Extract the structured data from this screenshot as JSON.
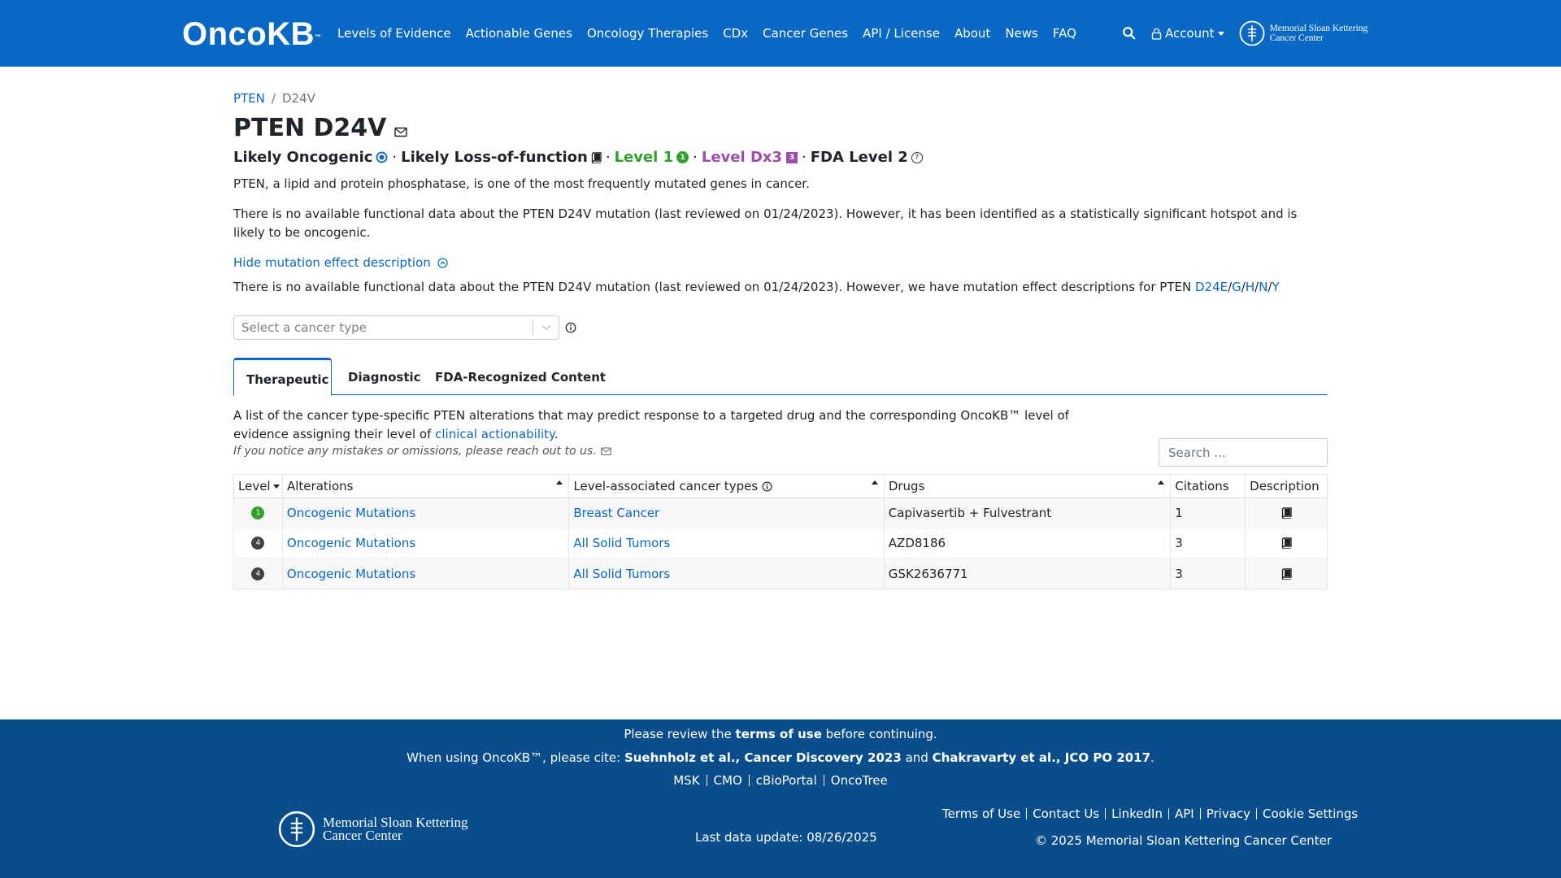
{
  "nav": {
    "logo_text": "OncoKB",
    "logo_tm": "™",
    "items": [
      "Levels of Evidence",
      "Actionable Genes",
      "Oncology Therapies",
      "CDx",
      "Cancer Genes",
      "API / License",
      "About",
      "News",
      "FAQ"
    ],
    "account_label": "Account",
    "msk_line1": "Memorial Sloan Kettering",
    "msk_line2": "Cancer Center"
  },
  "breadcrumb": {
    "gene": "PTEN",
    "sep": "/",
    "alteration": "D24V"
  },
  "title": "PTEN D24V",
  "summary": {
    "oncogenicity": "Likely Oncogenic",
    "mutation_effect": "Likely Loss-of-function",
    "level1": "Level 1",
    "level1_badge": "1",
    "level_dx": "Level Dx3",
    "level_dx_badge": "3",
    "fda_level": "FDA Level 2",
    "dot": "·",
    "help": "?"
  },
  "gene_summary": "PTEN, a lipid and protein phosphatase, is one of the most frequently mutated genes in cancer.",
  "variant_summary": "There is no available functional data about the PTEN D24V mutation (last reviewed on 01/24/2023). However, it has been identified as a statistically significant hotspot and is likely to be oncogenic.",
  "toggle_label": "Hide mutation effect description",
  "mutation_effect_text": "There is no available functional data about the PTEN D24V mutation (last reviewed on 01/24/2023). However, we have mutation effect descriptions for PTEN ",
  "mutation_links": [
    "D24E",
    "G",
    "H",
    "N",
    "Y"
  ],
  "link_sep": "/",
  "cancer_type_select": {
    "placeholder": "Select a cancer type"
  },
  "tabs": [
    "Therapeutic",
    "Diagnostic",
    "FDA-Recognized Content"
  ],
  "tab_description_1": "A list of the cancer type-specific PTEN alterations that may predict response to a targeted drug and the corresponding OncoKB™ level of evidence assigning their level of ",
  "tab_description_link": "clinical actionability",
  "tab_description_end": ".",
  "tab_note": "If you notice any mistakes or omissions, please reach out to us.",
  "table_search_placeholder": "Search ...",
  "table": {
    "headers": [
      "Level",
      "Alterations",
      "Level-associated cancer types",
      "Drugs",
      "Citations",
      "Description"
    ],
    "rows": [
      {
        "level": "1",
        "level_color": "#33a02c",
        "alteration": "Oncogenic Mutations",
        "cancer_type": "Breast Cancer",
        "drugs": "Capivasertib + Fulvestrant",
        "citations": "1"
      },
      {
        "level": "4",
        "level_color": "#424242",
        "alteration": "Oncogenic Mutations",
        "cancer_type": "All Solid Tumors",
        "drugs": "AZD8186",
        "citations": "3"
      },
      {
        "level": "4",
        "level_color": "#424242",
        "alteration": "Oncogenic Mutations",
        "cancer_type": "All Solid Tumors",
        "drugs": "GSK2636771",
        "citations": "3"
      }
    ]
  },
  "footer": {
    "review_pre": "Please review the ",
    "review_link": "terms of use",
    "review_post": " before continuing.",
    "cite_pre": "When using OncoKB™, please cite: ",
    "cite_1": "Suehnholz et al., Cancer Discovery 2023",
    "cite_and": " and ",
    "cite_2": "Chakravarty et al., JCO PO 2017",
    "cite_end": ".",
    "links": [
      "MSK",
      "CMO",
      "cBioPortal",
      "OncoTree"
    ],
    "msk_line1": "Memorial Sloan Kettering",
    "msk_line2": "Cancer Center",
    "last_update": "Last data update: 08/26/2025",
    "right_links": [
      "Terms of Use",
      "Contact Us",
      "LinkedIn",
      "API",
      "Privacy",
      "Cookie Settings"
    ],
    "copyright": "© 2025 Memorial Sloan Kettering Cancer Center"
  },
  "colors": {
    "brand": "#0968c3",
    "footer": "#0a4d8c",
    "level1": "#33a02c",
    "dx": "#9e4dac"
  }
}
